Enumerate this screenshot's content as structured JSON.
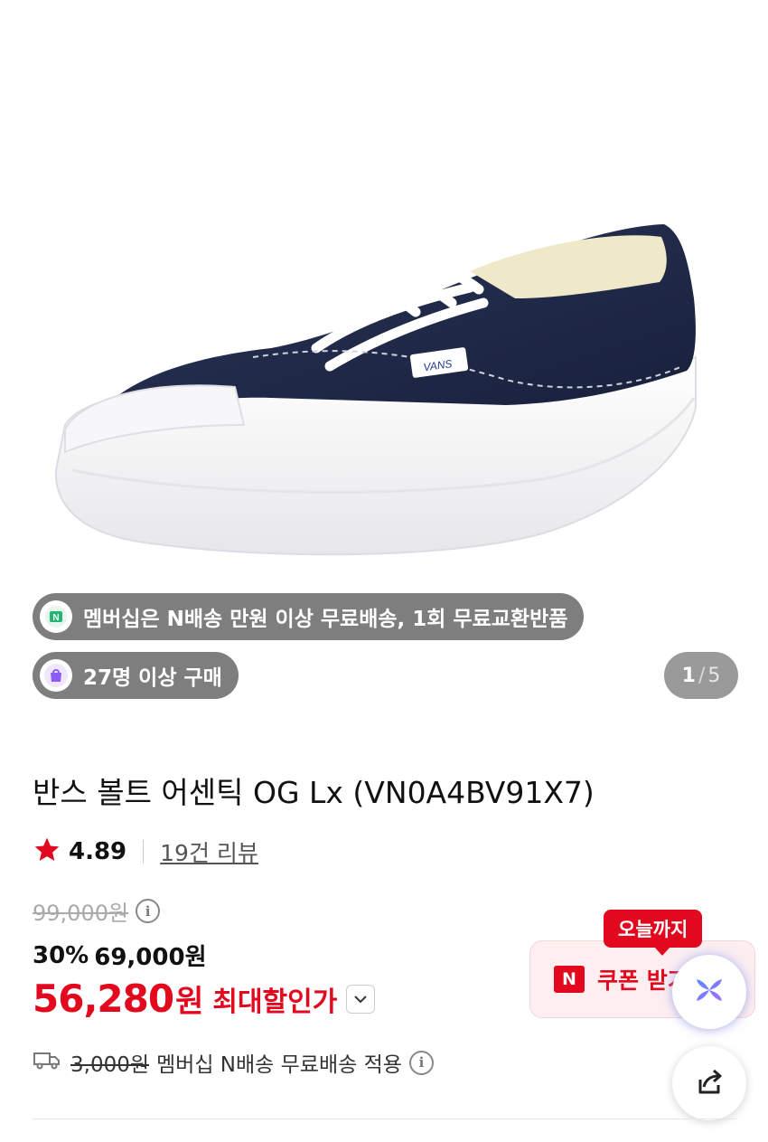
{
  "gallery": {
    "current": "1",
    "separator": "/",
    "total": "5"
  },
  "badges": {
    "membership": "멤버십은 N배송 만원 이상 무료배송, 1회 무료교환반품",
    "buyers": "27명 이상 구매"
  },
  "product": {
    "title": "반스 볼트 어센틱 OG Lx (VN0A4BV91X7)",
    "rating": "4.89",
    "reviews": "19건 리뷰"
  },
  "price": {
    "original": "99,000원",
    "discount_pct": "30%",
    "sale": "69,000원",
    "max_amount": "56,280",
    "max_unit": "원",
    "max_label": "최대할인가"
  },
  "shipping": {
    "original_fee": "3,000원",
    "text": "멤버십 N배송 무료배송 적용"
  },
  "coupon": {
    "tag": "오늘까지",
    "badge": "N",
    "label": "쿠폰 받기"
  },
  "colors": {
    "accent_red": "#e2081e",
    "shoe_navy": "#1f2a4a",
    "star": "#e2081e"
  },
  "icons": [
    "membership-n-icon",
    "bag-icon",
    "star-icon",
    "info-icon",
    "chevron-down-icon",
    "truck-icon",
    "ai-assistant-icon",
    "share-icon"
  ]
}
